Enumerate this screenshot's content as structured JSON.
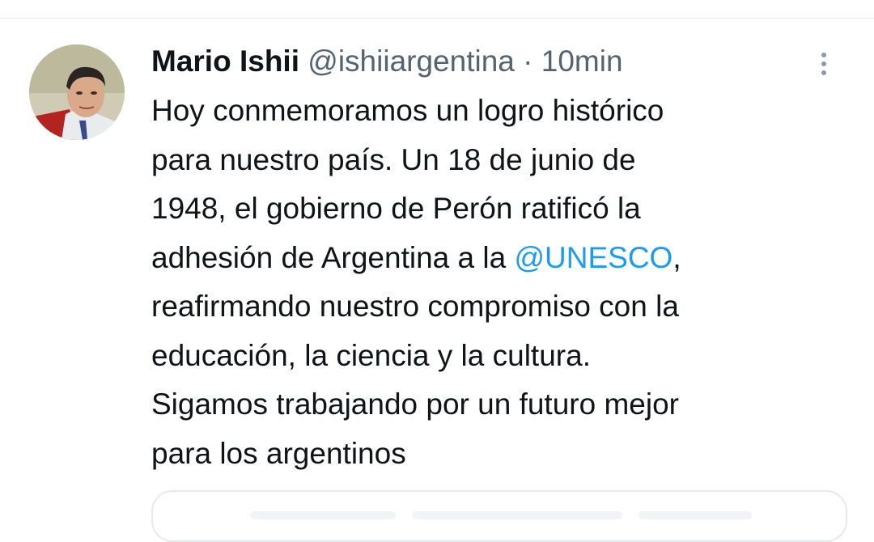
{
  "tweet": {
    "author": {
      "display_name": "Mario Ishii",
      "handle": "@ishiiargentina"
    },
    "separator": "·",
    "time": "10min",
    "more_icon": "more-vertical-icon",
    "body": {
      "line1": "Hoy conmemoramos un logro histórico",
      "line2": "para nuestro país. Un 18 de junio de",
      "line3": "1948, el gobierno de Perón ratificó la",
      "line4_prefix": "adhesión de Argentina a la ",
      "line4_mention": "@UNESCO",
      "line4_suffix": ",",
      "line5": "reafirmando nuestro compromiso con la",
      "line6": "educación, la ciencia y la cultura.",
      "line7": "Sigamos trabajando por un futuro mejor",
      "line8": "para los argentinos"
    }
  },
  "colors": {
    "text": "#0f1419",
    "secondary": "#536471",
    "link": "#1d9bf0",
    "border": "#e7e9ea"
  }
}
